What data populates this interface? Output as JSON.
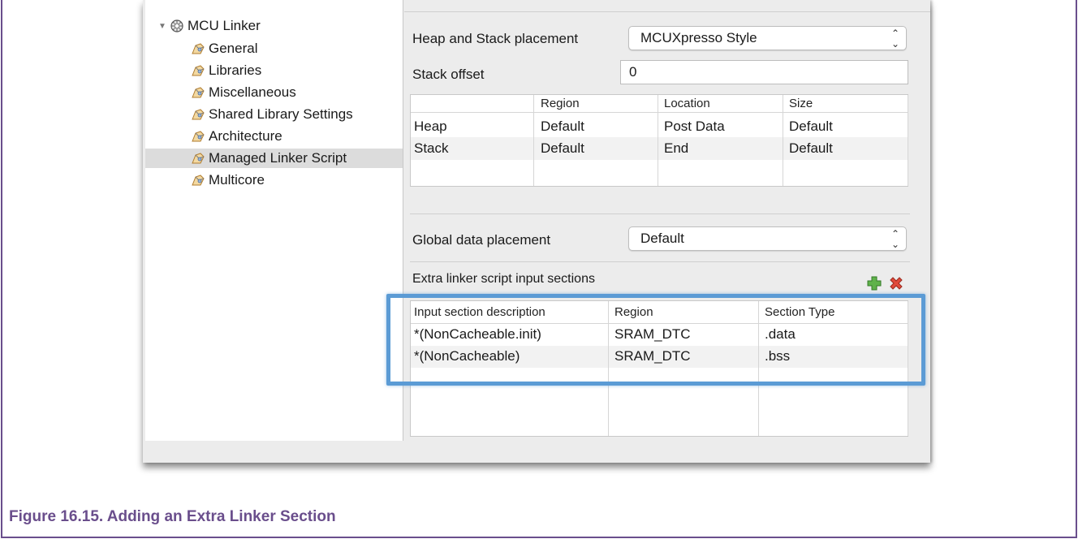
{
  "tree": {
    "root": "MCU Linker",
    "items": [
      "General",
      "Libraries",
      "Miscellaneous",
      "Shared Library Settings",
      "Architecture",
      "Managed Linker Script",
      "Multicore"
    ],
    "selected": "Managed Linker Script"
  },
  "heap_stack": {
    "placement_label": "Heap and Stack placement",
    "placement_value": "MCUXpresso Style",
    "offset_label": "Stack offset",
    "offset_value": "0",
    "columns": [
      "",
      "Region",
      "Location",
      "Size"
    ],
    "rows": [
      [
        "Heap",
        "Default",
        "Post Data",
        "Default"
      ],
      [
        "Stack",
        "Default",
        "End",
        "Default"
      ]
    ]
  },
  "global_data": {
    "label": "Global data placement",
    "value": "Default"
  },
  "extra_sections": {
    "label": "Extra linker script input sections",
    "add_icon": "green-plus-icon",
    "remove_icon": "red-x-icon",
    "columns": [
      "Input section description",
      "Region",
      "Section Type"
    ],
    "rows": [
      [
        "*(NonCacheable.init)",
        "SRAM_DTC",
        ".data"
      ],
      [
        "*(NonCacheable)",
        "SRAM_DTC",
        ".bss"
      ]
    ]
  },
  "caption": "Figure 16.15. Adding an Extra Linker Section",
  "colors": {
    "caption": "#6a4e8c",
    "highlight": "#5b9bd5",
    "selection": "#dcdcdc"
  }
}
